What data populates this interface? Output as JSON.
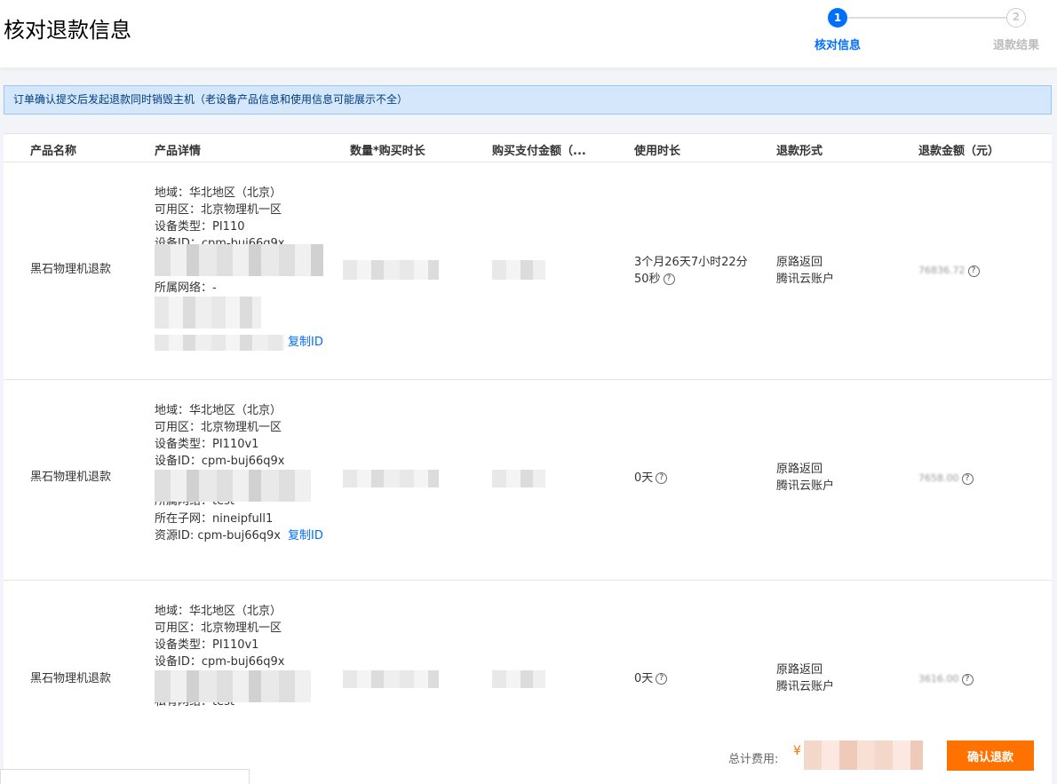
{
  "header": {
    "title": "核对退款信息",
    "steps": [
      {
        "number": "1",
        "label": "核对信息"
      },
      {
        "number": "2",
        "label": "退款结果"
      }
    ]
  },
  "notice": "订单确认提交后发起退款同时销毁主机（老设备产品信息和使用信息可能展示不全）",
  "table": {
    "columns": [
      "产品名称",
      "产品详情",
      "数量*购买时长",
      "购买支付金额（...",
      "使用时长",
      "退款形式",
      "退款金额（元）"
    ],
    "rows": [
      {
        "name": "黑石物理机退款",
        "details": [
          "地域：华北地区（北京）",
          "可用区：北京物理机一区",
          "设备类型：PI110",
          "设备ID：cpm-buj66q9x",
          "所属网络：-"
        ],
        "copy_label": "复制ID",
        "usage_line1": "3个月26天7小时22分",
        "usage_line2": "50秒",
        "refund_method_line1": "原路返回",
        "refund_method_line2": "腾讯云账户",
        "refund_amount": "76836.72"
      },
      {
        "name": "黑石物理机退款",
        "details": [
          "地域：华北地区（北京）",
          "可用区：北京物理机一区",
          "设备类型：PI110v1",
          "设备ID：cpm-buj66q9x",
          "所属网络：test",
          "所在子网：nineipfull1",
          "资源ID: cpm-buj66q9x"
        ],
        "copy_label": "复制ID",
        "usage": "0天",
        "refund_method_line1": "原路返回",
        "refund_method_line2": "腾讯云账户",
        "refund_amount": "7658.00"
      },
      {
        "name": "黑石物理机退款",
        "details": [
          "地域：华北地区（北京）",
          "可用区：北京物理机一区",
          "设备类型：PI110v1",
          "设备ID：cpm-buj66q9x",
          "私有网络：test"
        ],
        "usage": "0天",
        "refund_method_line1": "原路返回",
        "refund_method_line2": "腾讯云账户",
        "refund_amount": "3616.00"
      }
    ]
  },
  "footer": {
    "total_label": "总计费用:",
    "currency": "¥",
    "confirm_button": "确认退款"
  },
  "colors": {
    "primary": "#006eff",
    "accent": "#ff7200",
    "notice_bg": "#d5e7fa"
  }
}
